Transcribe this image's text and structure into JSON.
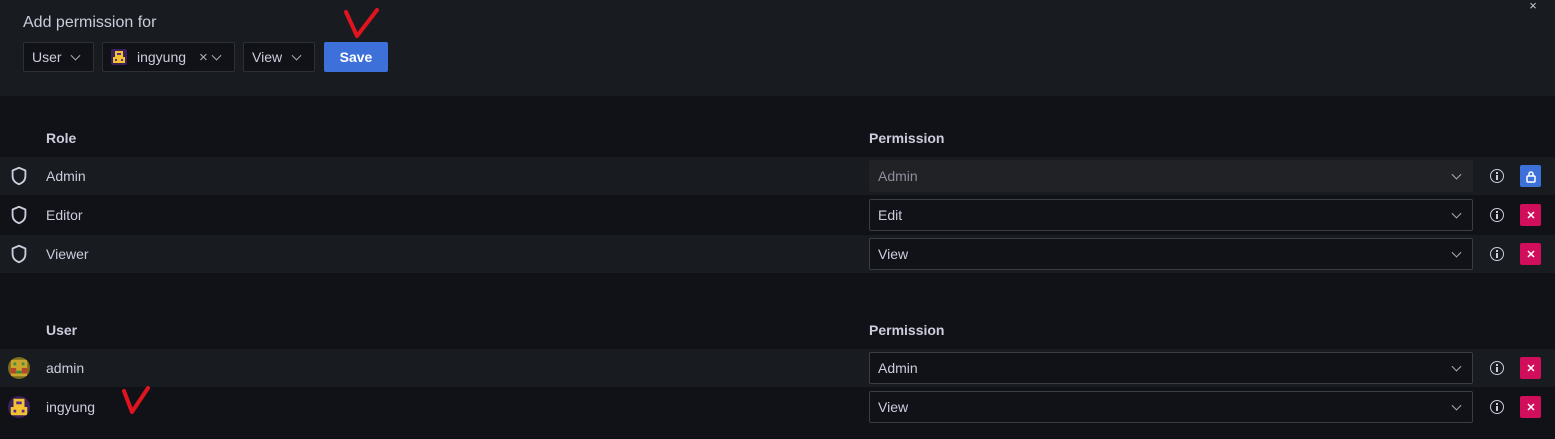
{
  "add_permission": {
    "title": "Add permission for",
    "close_glyph": "×",
    "type_select": {
      "value": "User"
    },
    "user_select": {
      "value": "ingyung",
      "clear_glyph": "×"
    },
    "level_select": {
      "value": "View"
    },
    "save_label": "Save"
  },
  "roles_section": {
    "header_label": "Role",
    "permission_header": "Permission",
    "rows": [
      {
        "name": "Admin",
        "permission": "Admin",
        "action": "lock",
        "disabled": true
      },
      {
        "name": "Editor",
        "permission": "Edit",
        "action": "delete",
        "disabled": false
      },
      {
        "name": "Viewer",
        "permission": "View",
        "action": "delete",
        "disabled": false
      }
    ]
  },
  "users_section": {
    "header_label": "User",
    "permission_header": "Permission",
    "rows": [
      {
        "name": "admin",
        "permission": "Admin",
        "action": "delete"
      },
      {
        "name": "ingyung",
        "permission": "View",
        "action": "delete"
      }
    ]
  },
  "icons": {
    "role_icon": "shield-icon",
    "info_icon": "info-circle-icon",
    "delete_icon": "times-icon",
    "lock_icon": "lock-icon"
  },
  "colors": {
    "primary": "#3d71d9",
    "danger": "#d10e5c",
    "annotation": "#e0141e"
  }
}
